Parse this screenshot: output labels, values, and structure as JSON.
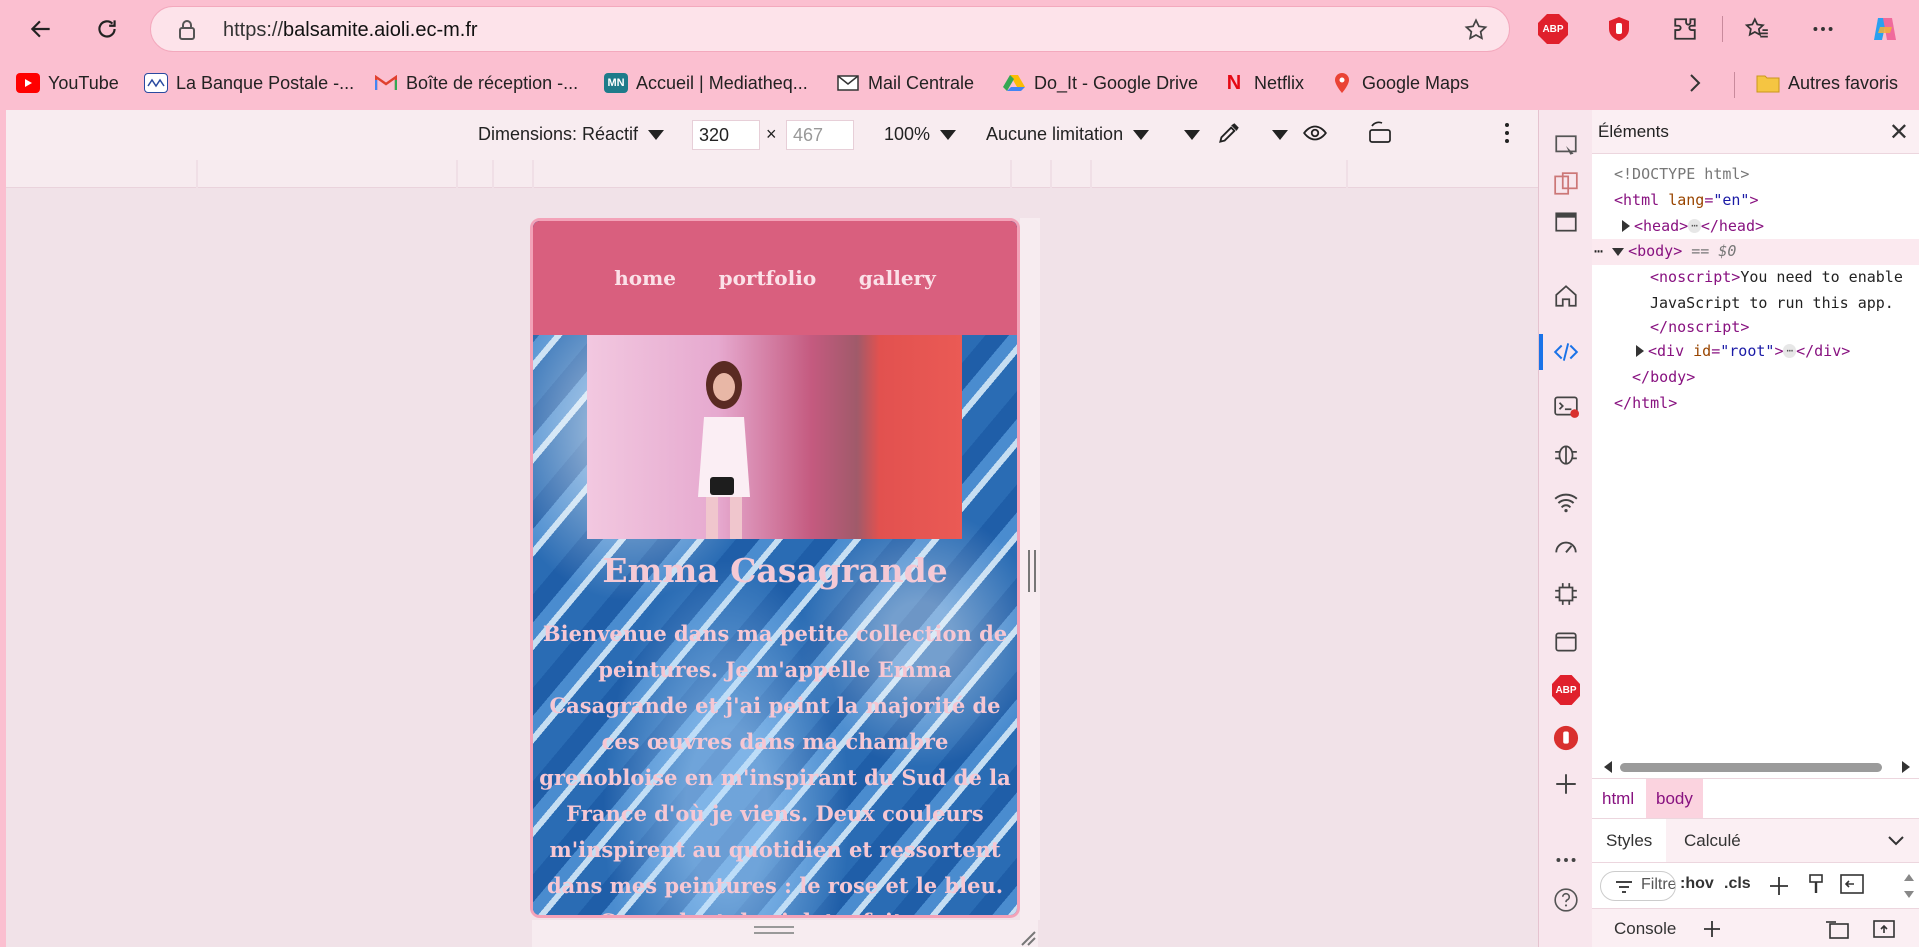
{
  "browser": {
    "url_prefix": "https://",
    "url_host": "balsamite.aioli.ec-m.fr",
    "bookmarks": [
      {
        "label": "YouTube",
        "icon": "youtube-icon"
      },
      {
        "label": "La Banque Postale -...",
        "icon": "banque-postale-icon"
      },
      {
        "label": "Boîte de réception -...",
        "icon": "gmail-icon"
      },
      {
        "label": "Accueil | Mediatheq...",
        "icon": "mediatheque-icon",
        "icon_text": "MN"
      },
      {
        "label": "Mail Centrale",
        "icon": "mail-icon"
      },
      {
        "label": "Do_It - Google Drive",
        "icon": "google-drive-icon"
      },
      {
        "label": "Netflix",
        "icon": "netflix-icon",
        "icon_text": "N"
      },
      {
        "label": "Google Maps",
        "icon": "google-maps-icon"
      }
    ],
    "other_bookmarks": "Autres favoris",
    "abp_label": "ABP"
  },
  "emulation": {
    "dimensions_label": "Dimensions: Réactif",
    "width": "320",
    "height": "467",
    "zoom": "100%",
    "throttle": "Aucune limitation"
  },
  "site": {
    "nav": [
      "home",
      "portfolio",
      "gallery"
    ],
    "title": "Emma Casagrande",
    "intro": "Bienvenue dans ma petite collection de peintures. Je m'appelle Emma Casagrande et j'ai peint la majorité de ces œuvres dans ma chambre grenobloise en m'inspirant du Sud de la France d'où je viens. Deux couleurs m'inspirent au quotidien et ressortent dans mes peintures : le rose et le bleu. Cependant, le violet a fait son"
  },
  "devtools": {
    "panel_title": "Éléments",
    "tree": {
      "doctype": "<!DOCTYPE html>",
      "html_open": "html",
      "lang_attr": "lang",
      "lang_val": "\"en\"",
      "head": "head",
      "body": "body",
      "body_marker": "== $0",
      "noscript": "noscript",
      "noscript_text_1": "You need to enable",
      "noscript_text_2": "JavaScript to run this app.",
      "div": "div",
      "id_attr": "id",
      "id_val": "\"root\"",
      "ellipsis": "⋯"
    },
    "breadcrumbs": [
      "html",
      "body"
    ],
    "styles_tabs": [
      "Styles",
      "Calculé"
    ],
    "filter_placeholder": "Filtrer",
    "hov": ":hov",
    "cls": ".cls",
    "console_label": "Console"
  },
  "colors": {
    "chrome": "#fbbfd0",
    "site_nav": "#d95f7e",
    "site_text": "#f6c7d3",
    "selection_blue": "#1a73e8"
  }
}
